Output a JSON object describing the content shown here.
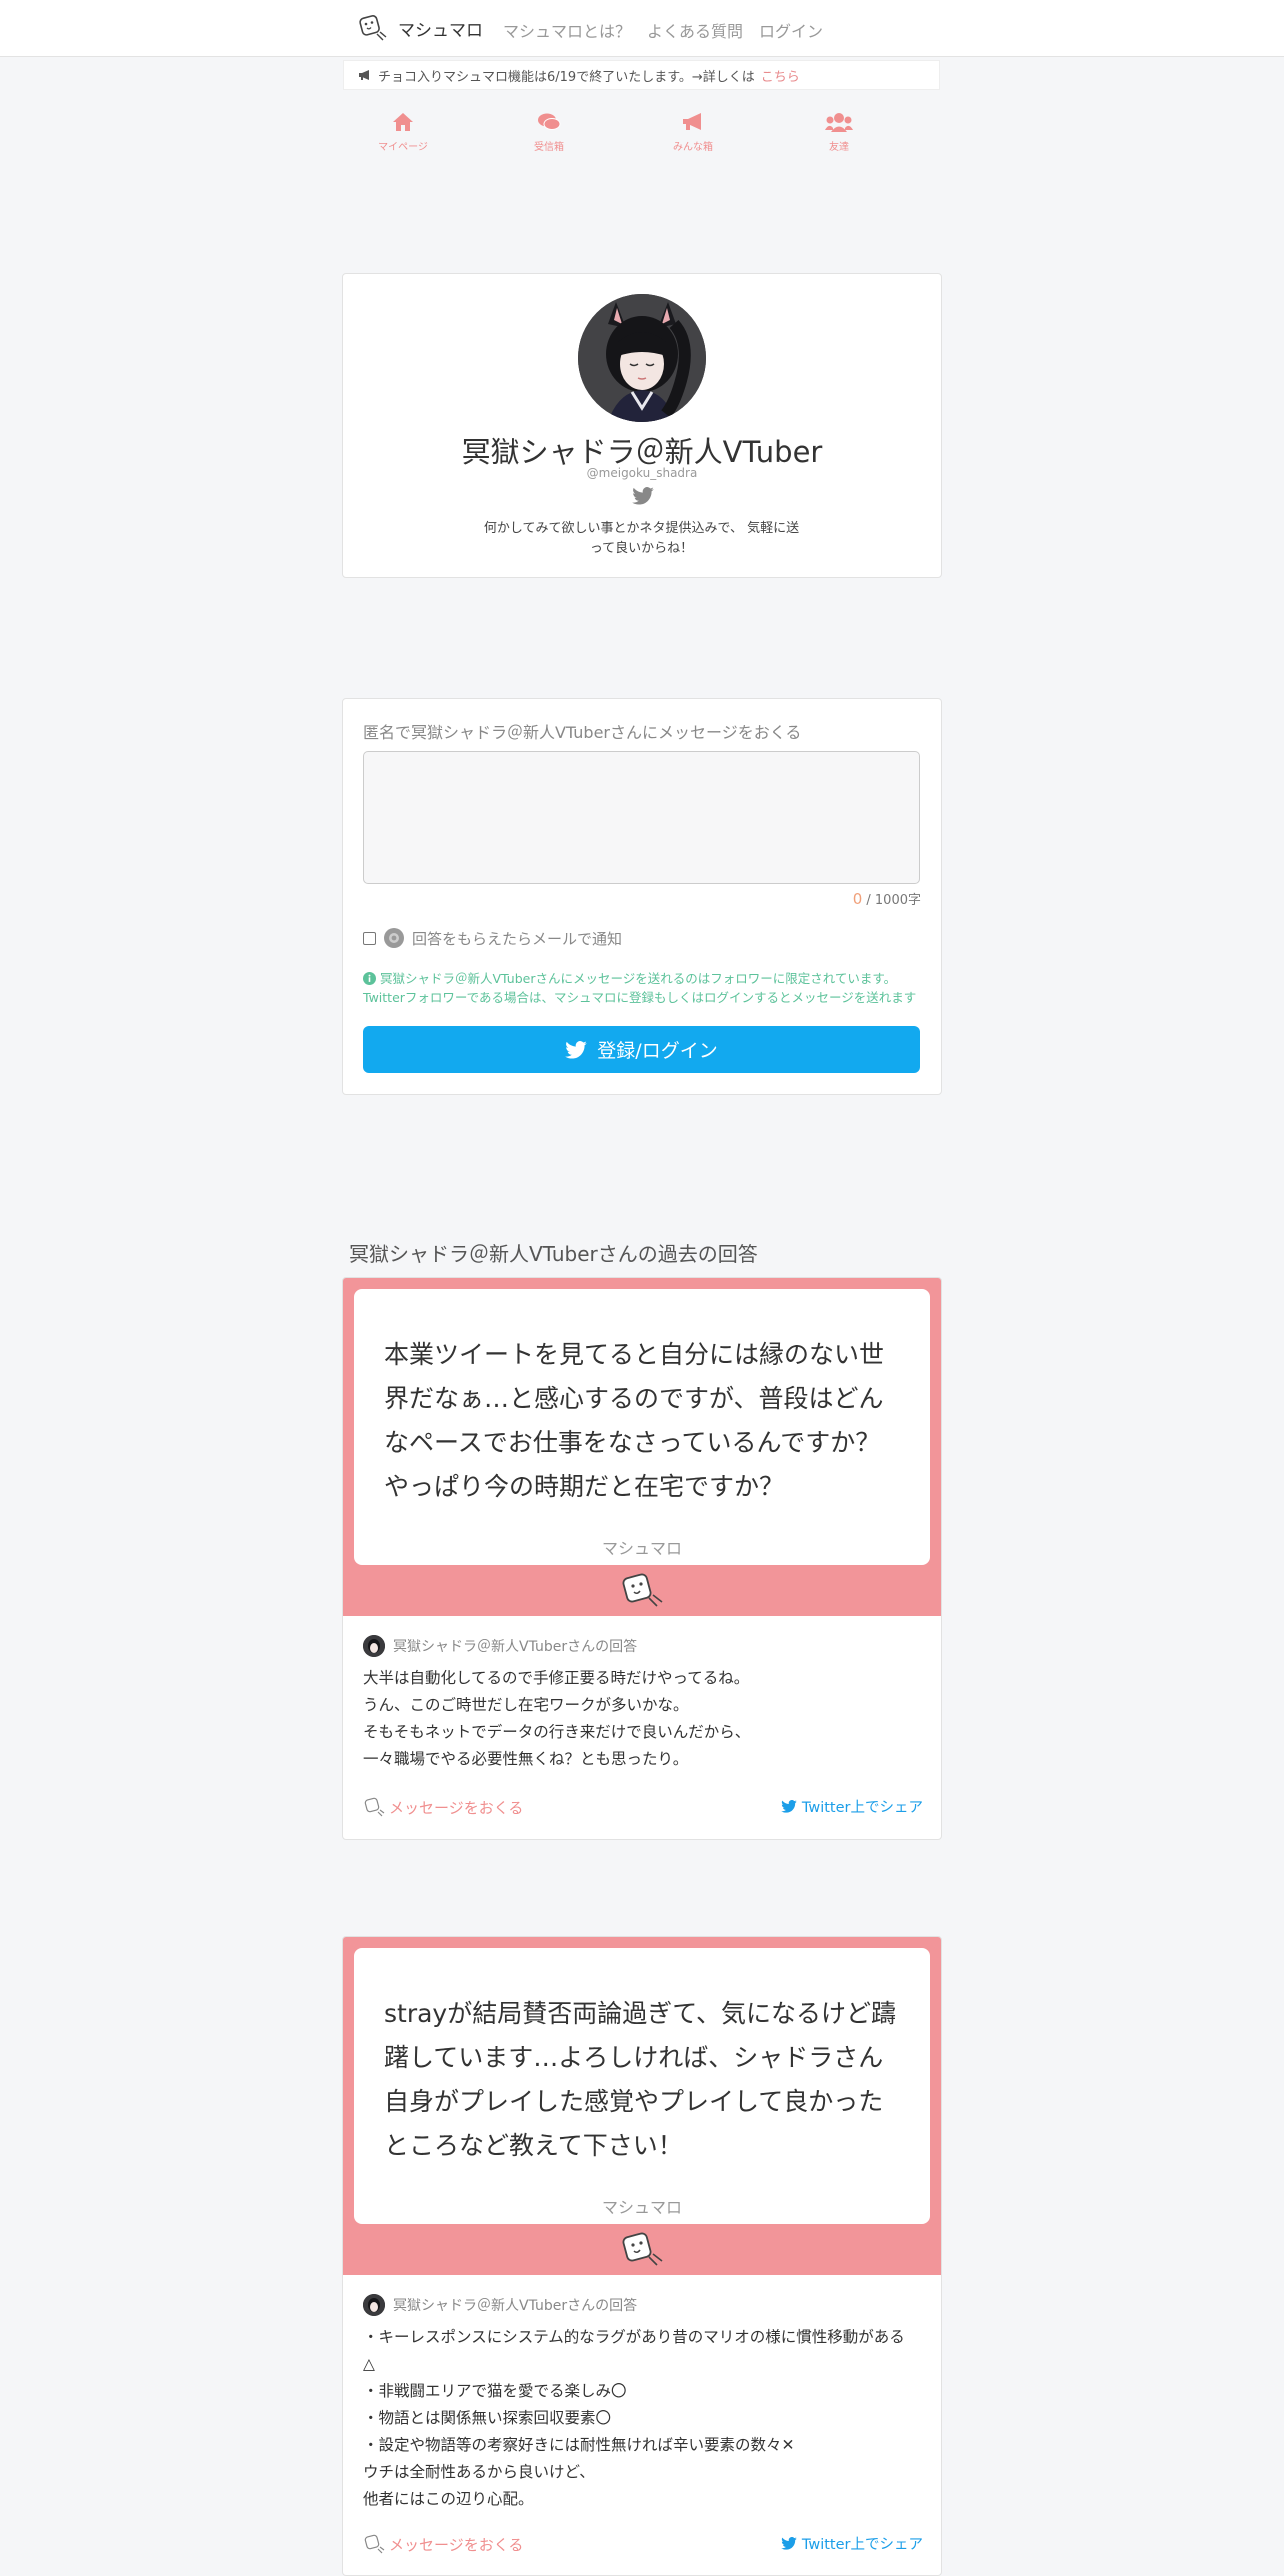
{
  "nav": {
    "brand": "マシュマロ",
    "links": [
      "マシュマロとは？",
      "よくある質問",
      "ログイン"
    ]
  },
  "announce": {
    "text": "チョコ入りマシュマロ機能は6/19で終了いたします。→詳しくは",
    "link": "こちら"
  },
  "tabs": [
    {
      "label": "マイページ",
      "icon": "home-icon"
    },
    {
      "label": "受信箱",
      "icon": "comments-icon"
    },
    {
      "label": "みんな箱",
      "icon": "bullhorn-icon"
    },
    {
      "label": "友達",
      "icon": "users-icon"
    }
  ],
  "profile": {
    "name": "冥獄シャドラ＠新人VTuber",
    "handle": "@meigoku_shadra",
    "bio": "何かしてみて欲しい事とかネタ提供込みで、 気軽に送って良いからね！"
  },
  "form": {
    "label": "匿名で冥獄シャドラ＠新人VTuberさんにメッセージをおくる",
    "count": "0",
    "max": "/ 1000字",
    "notify": "回答をもらえたらメールで通知",
    "notice": "冥獄シャドラ＠新人VTuberさんにメッセージを送れるのはフォロワーに限定されています。Twitterフォロワーである場合は、マシュマロに登録もしくはログインするとメッセージを送れます",
    "login": "登録/ログイン"
  },
  "answers_title": "冥獄シャドラ＠新人VTuberさんの過去の回答",
  "qa": [
    {
      "question": "本業ツイートを見てると自分には縁のない世界だなぁ…と感心するのですが、普段はどんなペースでお仕事をなさっているんですか？やっぱり今の時期だと在宅ですか？",
      "brand": "マシュマロ",
      "answer_head": "冥獄シャドラ＠新人VTuberさんの回答",
      "answer": "大半は自動化してるので手修正要る時だけやってるね。\nうん、このご時世だし在宅ワークが多いかな。\nそもそもネットでデータの行き来だけで良いんだから、\n一々職場でやる必要性無くね？とも思ったり。",
      "send": "メッセージをおくる",
      "share": "Twitter上でシェア"
    },
    {
      "question": "strayが結局賛否両論過ぎて、気になるけど躊躇しています…よろしければ、シャドラさん自身がプレイした感覚やプレイして良かったところなど教えて下さい！",
      "brand": "マシュマロ",
      "answer_head": "冥獄シャドラ＠新人VTuberさんの回答",
      "answer": "・キーレスポンスにシステム的なラグがあり昔のマリオの様に慣性移動がある△\n・非戦闘エリアで猫を愛でる楽しみ〇\n・物語とは関係無い探索回収要素〇\n・設定や物語等の考察好きには耐性無ければ辛い要素の数々✕\nウチは全耐性あるから良いけど、\n他者にはこの辺り心配。",
      "send": "メッセージをおくる",
      "share": "Twitter上でシェア"
    }
  ],
  "colors": {
    "accent_pink": "#f29599",
    "twitter_blue": "#12a9ef",
    "notice_green": "#5cc29a"
  }
}
